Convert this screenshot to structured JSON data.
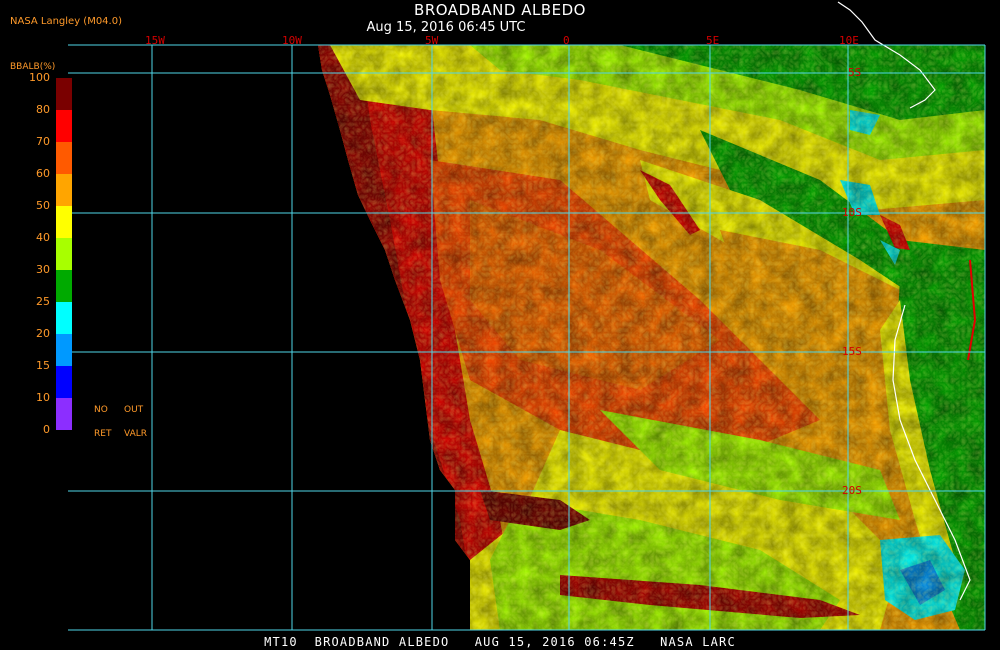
{
  "header": {
    "title": "BROADBAND ALBEDO",
    "subtitle": "Aug 15, 2016 06:45 UTC",
    "provider": "NASA Langley (M04.0)"
  },
  "legend": {
    "title": "BBALB(%)",
    "labels": [
      "100",
      "80",
      "70",
      "60",
      "50",
      "40",
      "30",
      "25",
      "20",
      "15",
      "10",
      "0"
    ],
    "colors": [
      "#7a0000",
      "#ff0000",
      "#ff5a00",
      "#ffa500",
      "#ffff00",
      "#a8ff00",
      "#00aa00",
      "#00ffff",
      "#0099ff",
      "#0000ff",
      "#8c2eff"
    ],
    "no_retrieval": [
      "NO",
      "RET"
    ],
    "out_of_range": [
      "OUT",
      "VALR"
    ]
  },
  "grid": {
    "longitude_labels": [
      "15W",
      "10W",
      "5W",
      "0",
      "5E",
      "10E"
    ],
    "latitude_labels": [
      "5S",
      "10S",
      "15S",
      "20S"
    ],
    "line_color": "#4fd6e8"
  },
  "footer": {
    "text": "MT10  BROADBAND ALBEDO   AUG 15, 2016 06:45Z   NASA LARC"
  }
}
